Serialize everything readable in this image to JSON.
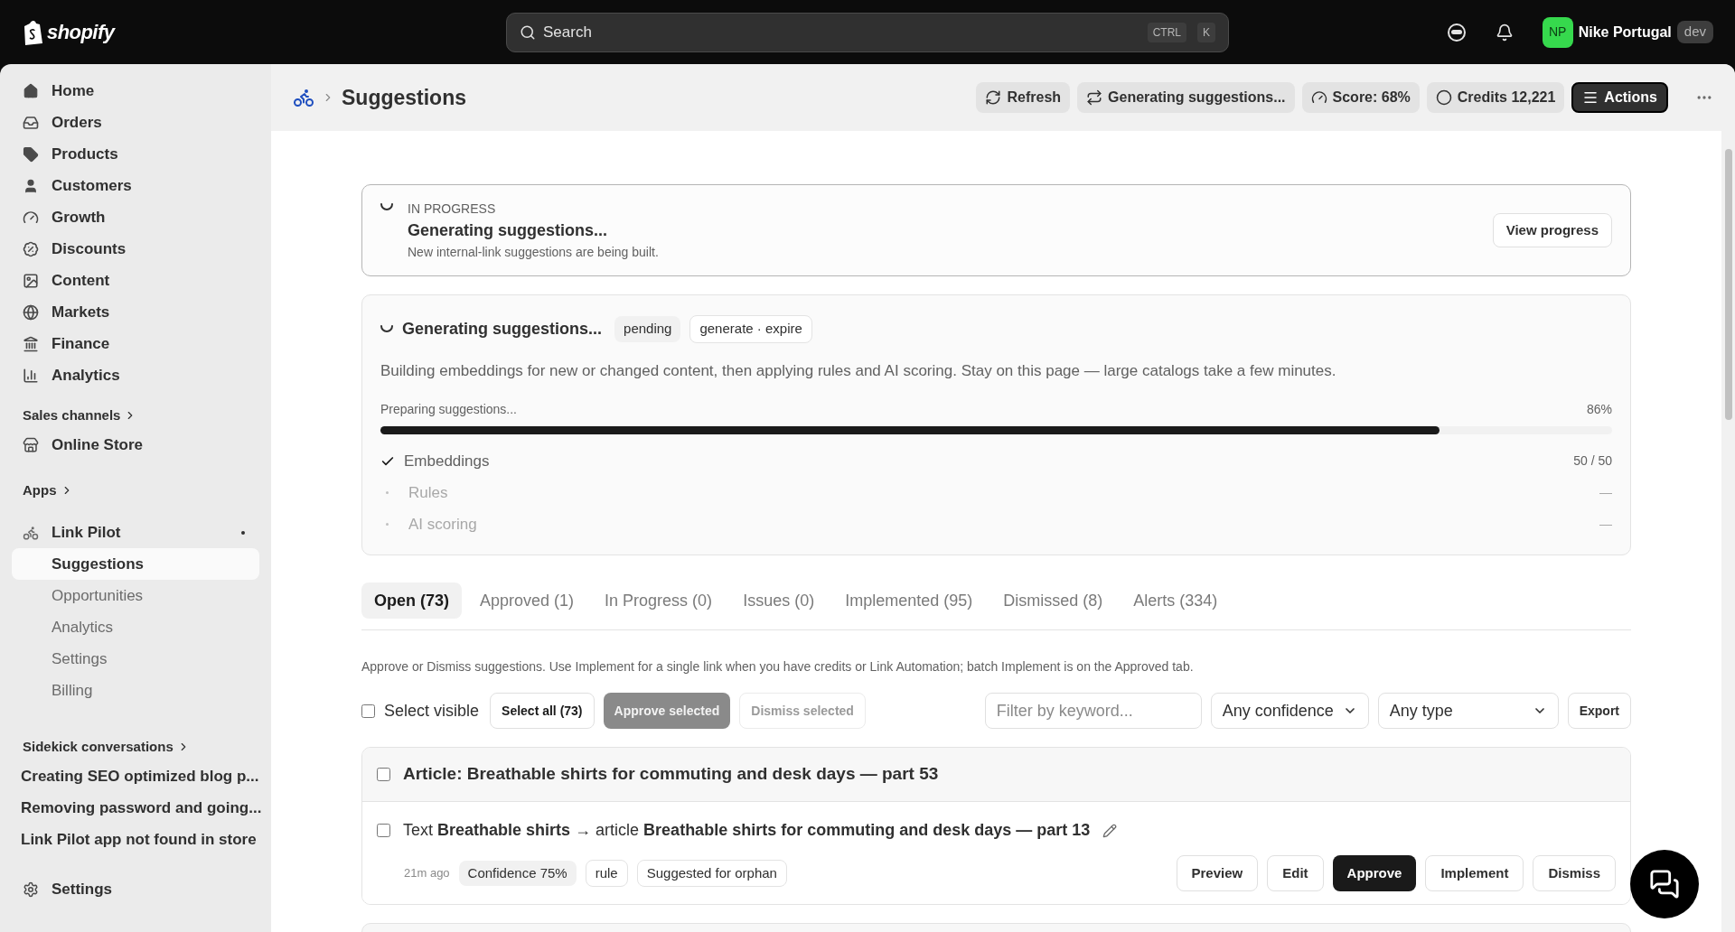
{
  "topbar": {
    "logo": "shopify",
    "search": {
      "placeholder": "Search",
      "keys": [
        "CTRL",
        "K"
      ]
    },
    "account": {
      "initials": "NP",
      "name": "Nike Portugal",
      "badge": "dev"
    }
  },
  "sidebar": {
    "nav": [
      "Home",
      "Orders",
      "Products",
      "Customers",
      "Growth",
      "Discounts",
      "Content",
      "Markets",
      "Finance",
      "Analytics"
    ],
    "sales_channels": {
      "heading": "Sales channels",
      "items": [
        "Online Store"
      ]
    },
    "apps": {
      "heading": "Apps",
      "app": {
        "name": "Link Pilot",
        "children": [
          {
            "label": "Suggestions",
            "selected": true
          },
          {
            "label": "Opportunities",
            "selected": false
          },
          {
            "label": "Analytics",
            "selected": false
          },
          {
            "label": "Settings",
            "selected": false
          },
          {
            "label": "Billing",
            "selected": false
          }
        ]
      }
    },
    "sidekick": {
      "heading": "Sidekick conversations",
      "items": [
        "Creating SEO optimized blog p...",
        "Removing password and going...",
        "Link Pilot app not found in store"
      ]
    },
    "settings": "Settings"
  },
  "header": {
    "title": "Suggestions",
    "buttons": [
      {
        "label": "Refresh",
        "kind": "refresh"
      },
      {
        "label": "Generating suggestions...",
        "kind": "sync"
      },
      {
        "label": "Score: 68%",
        "kind": "score"
      },
      {
        "label": "Credits 12,221",
        "kind": "credits"
      },
      {
        "label": "Actions",
        "kind": "primary"
      }
    ]
  },
  "banner": {
    "status": "IN PROGRESS",
    "title": "Generating suggestions...",
    "description": "New internal-link suggestions are being built.",
    "button": "View progress"
  },
  "job": {
    "title": "Generating suggestions...",
    "badges": [
      {
        "label": "pending",
        "kind": "filled"
      },
      {
        "label": "generate · expire",
        "kind": "outline"
      }
    ],
    "description": "Building embeddings for new or changed content, then applying rules and AI scoring. Stay on this page — large catalogs take a few minutes.",
    "progress_label": "Preparing suggestions...",
    "progress_reading": "86%",
    "level": 0.86,
    "steps": [
      {
        "label": "Embeddings",
        "done": true,
        "reading": "50 / 50"
      },
      {
        "label": "Rules",
        "done": false,
        "reading": "—"
      },
      {
        "label": "AI scoring",
        "done": false,
        "reading": "—"
      }
    ]
  },
  "tabs": [
    {
      "label": "Open (73)",
      "selected": true
    },
    {
      "label": "Approved (1)",
      "selected": false
    },
    {
      "label": "In Progress (0)",
      "selected": false
    },
    {
      "label": "Issues (0)",
      "selected": false
    },
    {
      "label": "Implemented (95)",
      "selected": false
    },
    {
      "label": "Dismissed (8)",
      "selected": false
    },
    {
      "label": "Alerts (334)",
      "selected": false
    }
  ],
  "help": "Approve or Dismiss suggestions. Use Implement for a single link when you have credits or Link Automation; batch Implement is on the Approved tab.",
  "toolbar": {
    "select_visible": {
      "label": "Select visible",
      "checked": false
    },
    "buttons": [
      {
        "label": "Select all (73)",
        "disabled": false,
        "kind": "outline"
      },
      {
        "label": "Approve selected",
        "disabled": true,
        "kind": "filled"
      },
      {
        "label": "Dismiss selected",
        "disabled": true,
        "kind": "outline"
      }
    ],
    "filter": {
      "placeholder": "Filter by keyword..."
    },
    "selects": [
      "Any confidence",
      "Any type"
    ],
    "export": "Export"
  },
  "groups": [
    {
      "title": "Article: Breathable shirts for commuting and desk days — part 53",
      "checked": false,
      "suggestions": [
        {
          "checked": false,
          "text": "Text **Breathable shirts** → article **Breathable shirts for commuting and desk days — part 13**",
          "time": "21m ago",
          "tags": [
            {
              "label": "Confidence 75%",
              "kind": "filled"
            },
            {
              "label": "rule",
              "kind": "outline"
            },
            {
              "label": "Suggested for orphan",
              "kind": "outline"
            }
          ],
          "actions": [
            {
              "label": "Preview",
              "kind": "outline"
            },
            {
              "label": "Edit",
              "kind": "outline"
            },
            {
              "label": "Approve",
              "kind": "primary"
            },
            {
              "label": "Implement",
              "kind": "outline"
            },
            {
              "label": "Dismiss",
              "kind": "outline"
            }
          ]
        }
      ]
    }
  ]
}
